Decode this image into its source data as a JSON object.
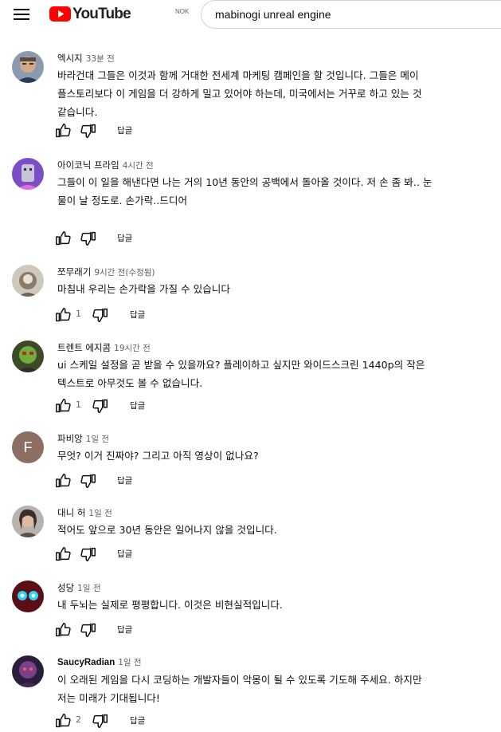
{
  "header": {
    "logo_text": "YouTube",
    "region": "NOK",
    "search_value": "mabinogi unreal engine"
  },
  "comments": [
    {
      "author": "엑시지",
      "time": "33분 전",
      "lines": [
        "바라건대 그들은 이것과 함께 거대한 전세계 마케팅 캠페인을 할 것입니다. 그들은 메이",
        "플스토리보다 이 게임을 더 강하게 밀고 있어야 하는데, 미국에서는 거꾸로 하고 있는 것",
        "같습니다."
      ],
      "likes": "",
      "reply": "답글"
    },
    {
      "author": "아이코닉 프라임",
      "time": "4시간 전",
      "lines": [
        "그들이 이 일을 해낸다면 나는 거의 10년 동안의 공백에서 돌아올 것이다. 저 손 좀 봐.. 눈",
        "물이 날 정도로. 손가락..드디어"
      ],
      "likes": "",
      "reply": "답글"
    },
    {
      "author": "쪼무래기",
      "time": "9시간 전(수정됨)",
      "lines": [
        "마침내 우리는 손가락을 가질 수 있습니다"
      ],
      "likes": "1",
      "reply": "답글"
    },
    {
      "author": "트렌트 에지콤",
      "time": "19시간 전",
      "lines": [
        "ui 스케일 설정을 곧 받을 수 있을까요? 플레이하고 싶지만 와이드스크린 1440p의 작은",
        "텍스트로 아무것도 볼 수 없습니다."
      ],
      "likes": "1",
      "reply": "답글"
    },
    {
      "author": "파비앙",
      "time": "1일 전",
      "lines": [
        "무엇? 이거 진짜야? 그리고 아직 영상이 없나요?"
      ],
      "likes": "",
      "reply": "답글",
      "avatar_letter": "F"
    },
    {
      "author": "대니 허",
      "time": "1일 전",
      "lines": [
        "적어도 앞으로 30년 동안은 일어나지 않을 것입니다."
      ],
      "likes": "",
      "reply": "답글"
    },
    {
      "author": "성당",
      "time": "1일 전",
      "lines": [
        "내 두뇌는 실제로 평평합니다. 이것은 비현실적입니다."
      ],
      "likes": "",
      "reply": "답글"
    },
    {
      "author": "SaucyRadian",
      "time": "1일 전",
      "lines": [
        "이 오래된 게임을 다시 코딩하는 개발자들이 악몽이 될 수 있도록 기도해 주세요. 하지만",
        "저는 미래가 기대됩니다!"
      ],
      "likes": "2",
      "reply": "답글"
    }
  ]
}
